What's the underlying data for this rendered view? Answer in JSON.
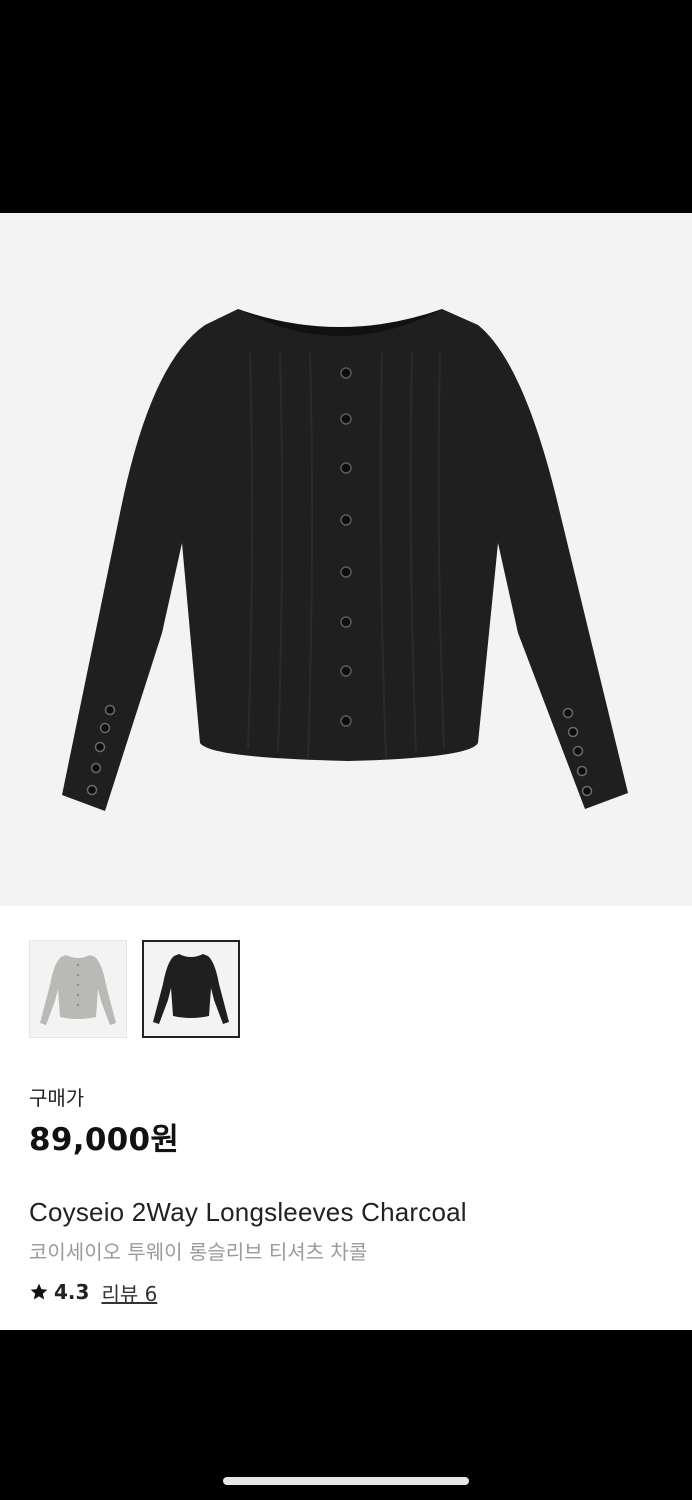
{
  "product": {
    "image_icon": "charcoal-longsleeve-cardigan-photo",
    "thumbnails": [
      {
        "icon": "gray-longsleeve-thumbnail",
        "color": "#b9b9b6",
        "selected": false
      },
      {
        "icon": "charcoal-longsleeve-thumbnail",
        "color": "#1f1f1f",
        "selected": true
      }
    ],
    "price_label": "구매가",
    "price": "89,000원",
    "name_en": "Coyseio 2Way Longsleeves Charcoal",
    "name_ko": "코이세이오 투웨이 롱슬리브 티셔츠 차콜",
    "rating": "4.3",
    "review_text": "리뷰 6",
    "rating_icon": "star-icon"
  },
  "colors": {
    "hero_background": "#f3f3f3",
    "garment": "#1f1f1f",
    "accent_text": "#111111",
    "muted_text": "#9a9a9a"
  }
}
